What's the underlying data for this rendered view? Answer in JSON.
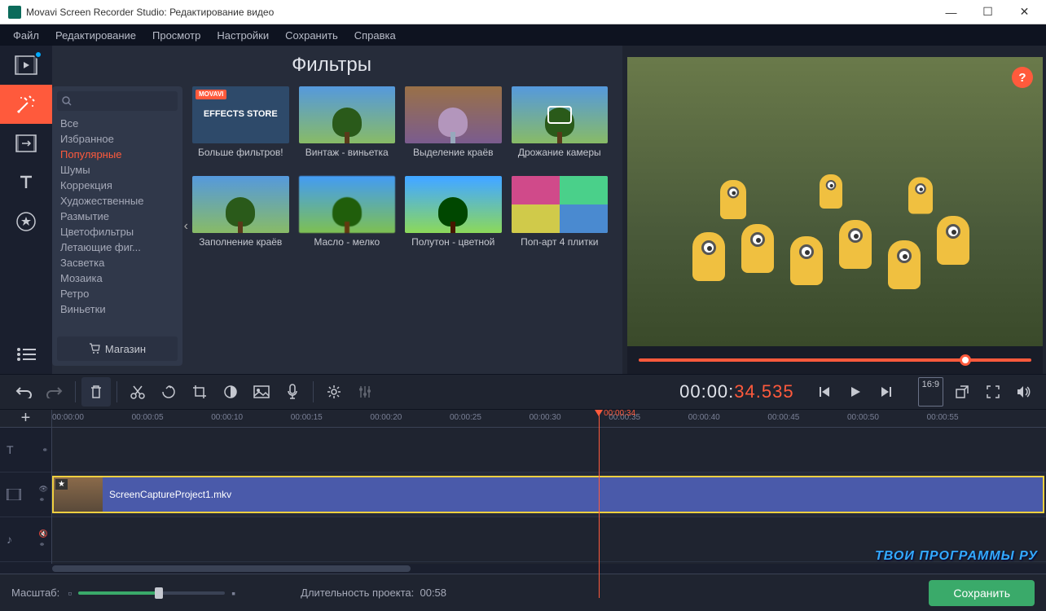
{
  "window": {
    "title": "Movavi Screen Recorder Studio: Редактирование видео"
  },
  "menubar": [
    "Файл",
    "Редактирование",
    "Просмотр",
    "Настройки",
    "Сохранить",
    "Справка"
  ],
  "panel": {
    "title": "Фильтры",
    "search_placeholder": "",
    "categories": [
      "Все",
      "Избранное",
      "Популярные",
      "Шумы",
      "Коррекция",
      "Художественные",
      "Размытие",
      "Цветофильтры",
      "Летающие фиг...",
      "Засветка",
      "Мозаика",
      "Ретро",
      "Виньетки"
    ],
    "active_category_index": 2,
    "shop_label": "Магазин",
    "filters": [
      {
        "label": "Больше фильтров!",
        "type": "store",
        "store_text": "EFFECTS STORE",
        "store_badge": "MOVAVI"
      },
      {
        "label": "Винтаж - виньетка",
        "type": "tree"
      },
      {
        "label": "Выделение краёв",
        "type": "tree"
      },
      {
        "label": "Дрожание камеры",
        "type": "camera"
      },
      {
        "label": "Заполнение краёв",
        "type": "tree"
      },
      {
        "label": "Масло - мелко",
        "type": "tree"
      },
      {
        "label": "Полутон - цветной",
        "type": "tree"
      },
      {
        "label": "Поп-арт 4 плитки",
        "type": "popart"
      }
    ]
  },
  "preview": {
    "help": "?",
    "progress_percent": 86
  },
  "timecode": {
    "white": "00:00:",
    "orange": "34.535"
  },
  "aspect_label": "16:9",
  "timeline": {
    "ticks": [
      "00:00:00",
      "00:00:05",
      "00:00:10",
      "00:00:15",
      "00:00:20",
      "00:00:25",
      "00:00:30",
      "00:00:35",
      "00:00:40",
      "00:00:45",
      "00:00:50",
      "00:00:55"
    ],
    "playhead_label": "00:00:34",
    "clip_name": "ScreenCaptureProject1.mkv"
  },
  "bottom": {
    "zoom_label": "Масштаб:",
    "duration_label": "Длительность проекта:",
    "duration_value": "00:58",
    "save_label": "Сохранить"
  },
  "watermark": "ТВОИ ПРОГРАММЫ РУ"
}
